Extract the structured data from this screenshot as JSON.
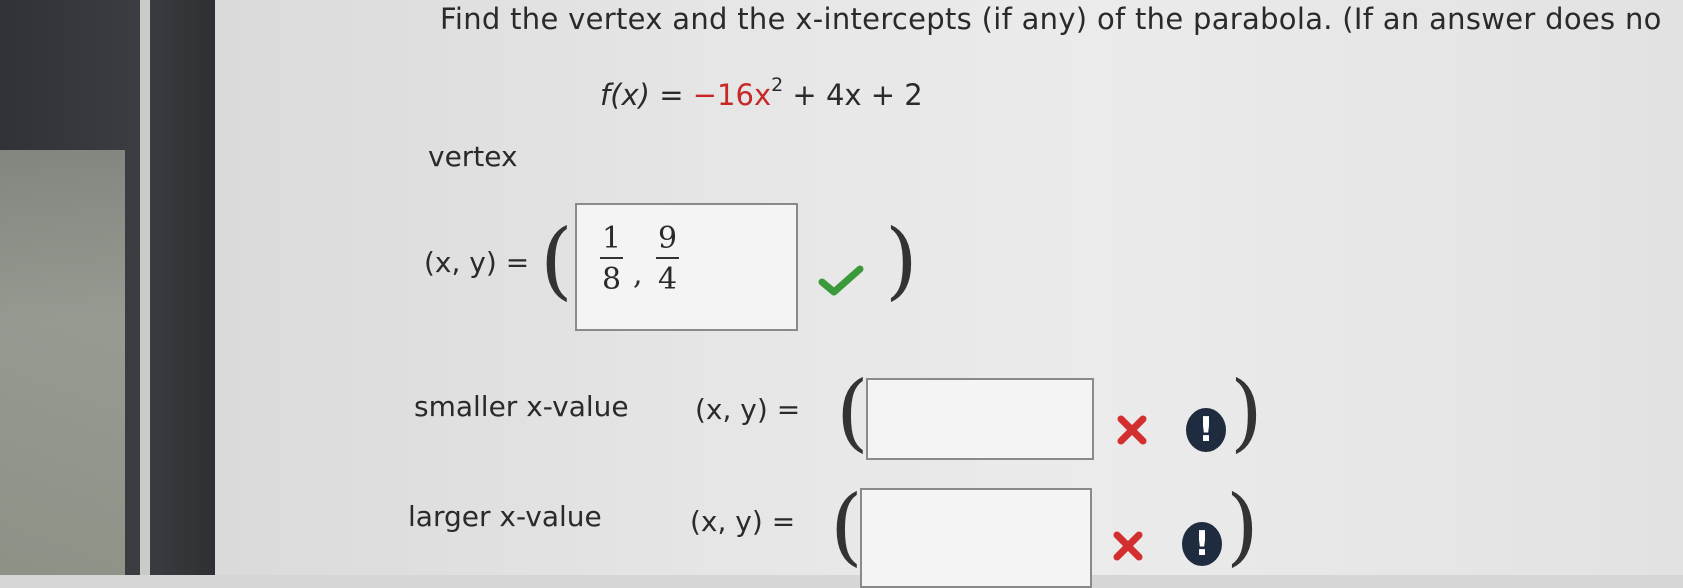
{
  "question": "Find the vertex and the x-intercepts (if any) of the parabola. (If an answer does no",
  "function": {
    "lhs": "f(x) = ",
    "coef": "−16x",
    "exp": "2",
    "rest": " + 4x + 2"
  },
  "vertex": {
    "label": "vertex",
    "xy_label": "(x, y) =",
    "x_num": "1",
    "x_den": "8",
    "y_num": "9",
    "y_den": "4",
    "status": "correct"
  },
  "smaller": {
    "label": "smaller x-value",
    "xy_label": "(x, y)  =",
    "value": "",
    "status": "incorrect"
  },
  "larger": {
    "label": "larger x-value",
    "xy_label": "(x, y)  =",
    "value": "",
    "status": "incorrect"
  },
  "colors": {
    "correct": "#3a9a3a",
    "incorrect": "#d32f2f",
    "alert": "#1f2c3f",
    "coef": "#c62828"
  },
  "icons": [
    "check-icon",
    "cross-icon",
    "exclamation-icon"
  ]
}
